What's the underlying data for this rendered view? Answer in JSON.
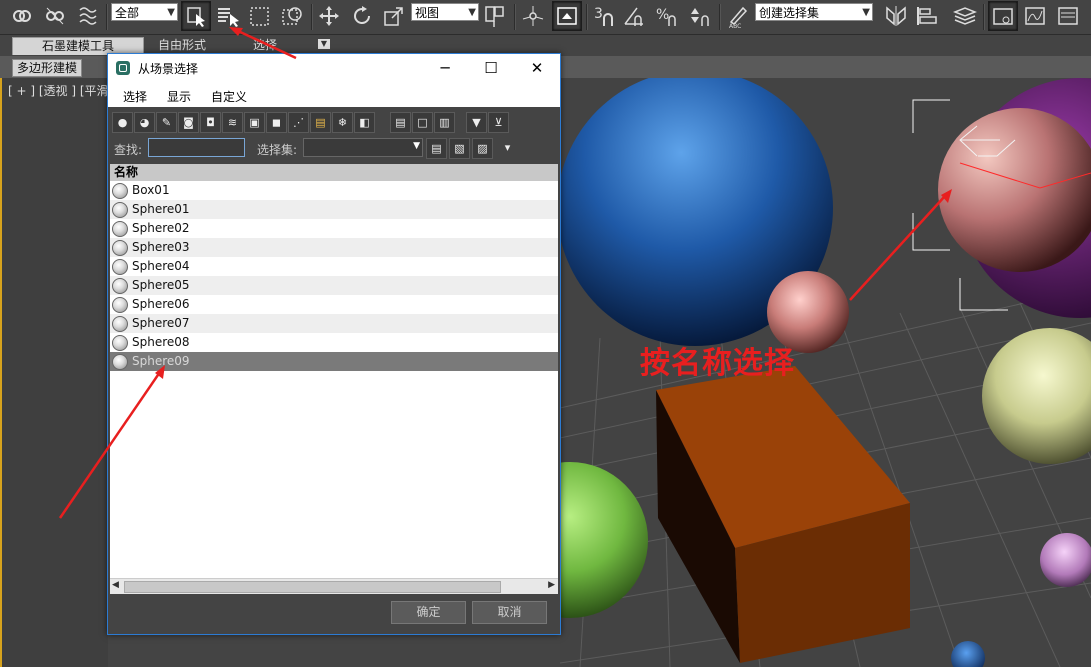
{
  "toolbar": {
    "filter_value": "全部",
    "ref_coord_value": "视图",
    "named_set_value": "创建选择集",
    "icons": [
      "link-icon",
      "unlink-icon",
      "bind-spacewarp-icon",
      "select-object-icon",
      "select-by-name-icon",
      "rect-region-icon",
      "window-crossing-icon",
      "move-icon",
      "rotate-icon",
      "scale-icon",
      "pivot-icon",
      "select-manipulate-icon",
      "keyboard-shortcut-icon",
      "snap-3-icon",
      "angle-snap-icon",
      "percent-snap-icon",
      "spinner-snap-icon",
      "edit-named-sets-icon",
      "mirror-icon",
      "align-icon",
      "layer-manager-icon",
      "curve-editor-icon",
      "schematic-icon",
      "material-editor-icon",
      "render-setup-icon",
      "rendered-frame-icon"
    ]
  },
  "ribbon": {
    "tabs": [
      "石墨建模工具",
      "自由形式",
      "选择"
    ],
    "subtab": "多边形建模"
  },
  "viewport_left": {
    "label": "[ + ] [透视 ] [平滑"
  },
  "dialog": {
    "title": "从场景选择",
    "menu": [
      "选择",
      "显示",
      "自定义"
    ],
    "find_label": "查找:",
    "find_value": "",
    "selset_label": "选择集:",
    "column_header": "名称",
    "items": [
      "Box01",
      "Sphere01",
      "Sphere02",
      "Sphere03",
      "Sphere04",
      "Sphere05",
      "Sphere06",
      "Sphere07",
      "Sphere08",
      "Sphere09"
    ],
    "selected_item": "Sphere09",
    "ok_label": "确定",
    "cancel_label": "取消"
  },
  "annotation": {
    "text": "按名称选择",
    "color": "#e81f1f"
  }
}
